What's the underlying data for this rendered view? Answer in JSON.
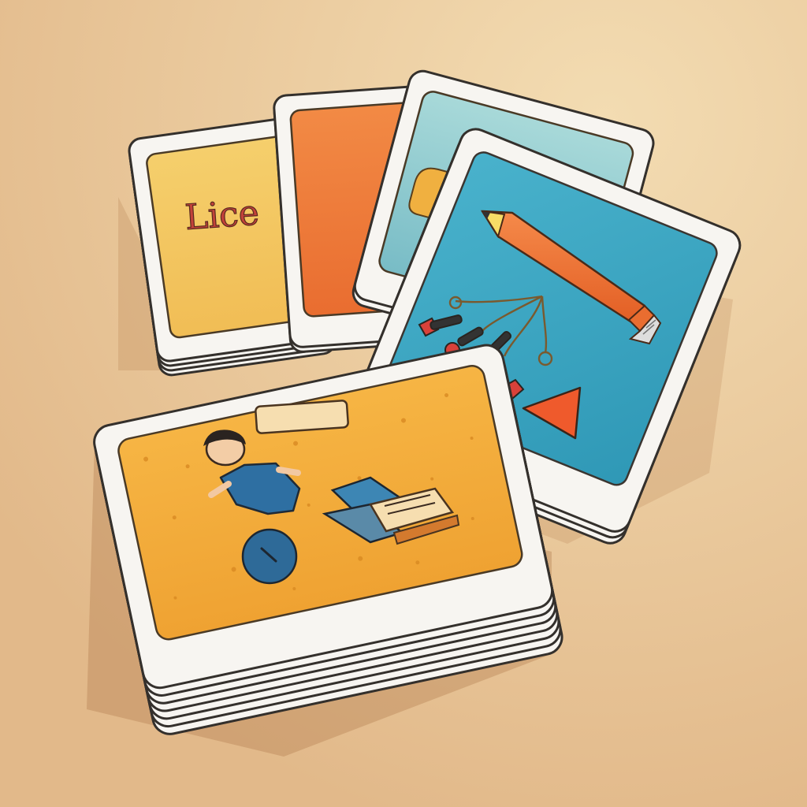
{
  "cards": {
    "yellow_card_label": "Lice"
  },
  "colors": {
    "background": "#e9c9a0",
    "card_white": "#f7f5f1",
    "card_outline": "#34302c",
    "yellow_panel": "#f2c04f",
    "orange_panel": "#ee7d3d",
    "teal_panel": "#8cccd0",
    "blue_panel": "#3ea8c4",
    "sponge_panel": "#f0a83a"
  },
  "icons": [
    "pencil-icon",
    "triangle-icon",
    "pins-icon",
    "person-icon",
    "book-icon",
    "button-icon",
    "plank-icon"
  ]
}
